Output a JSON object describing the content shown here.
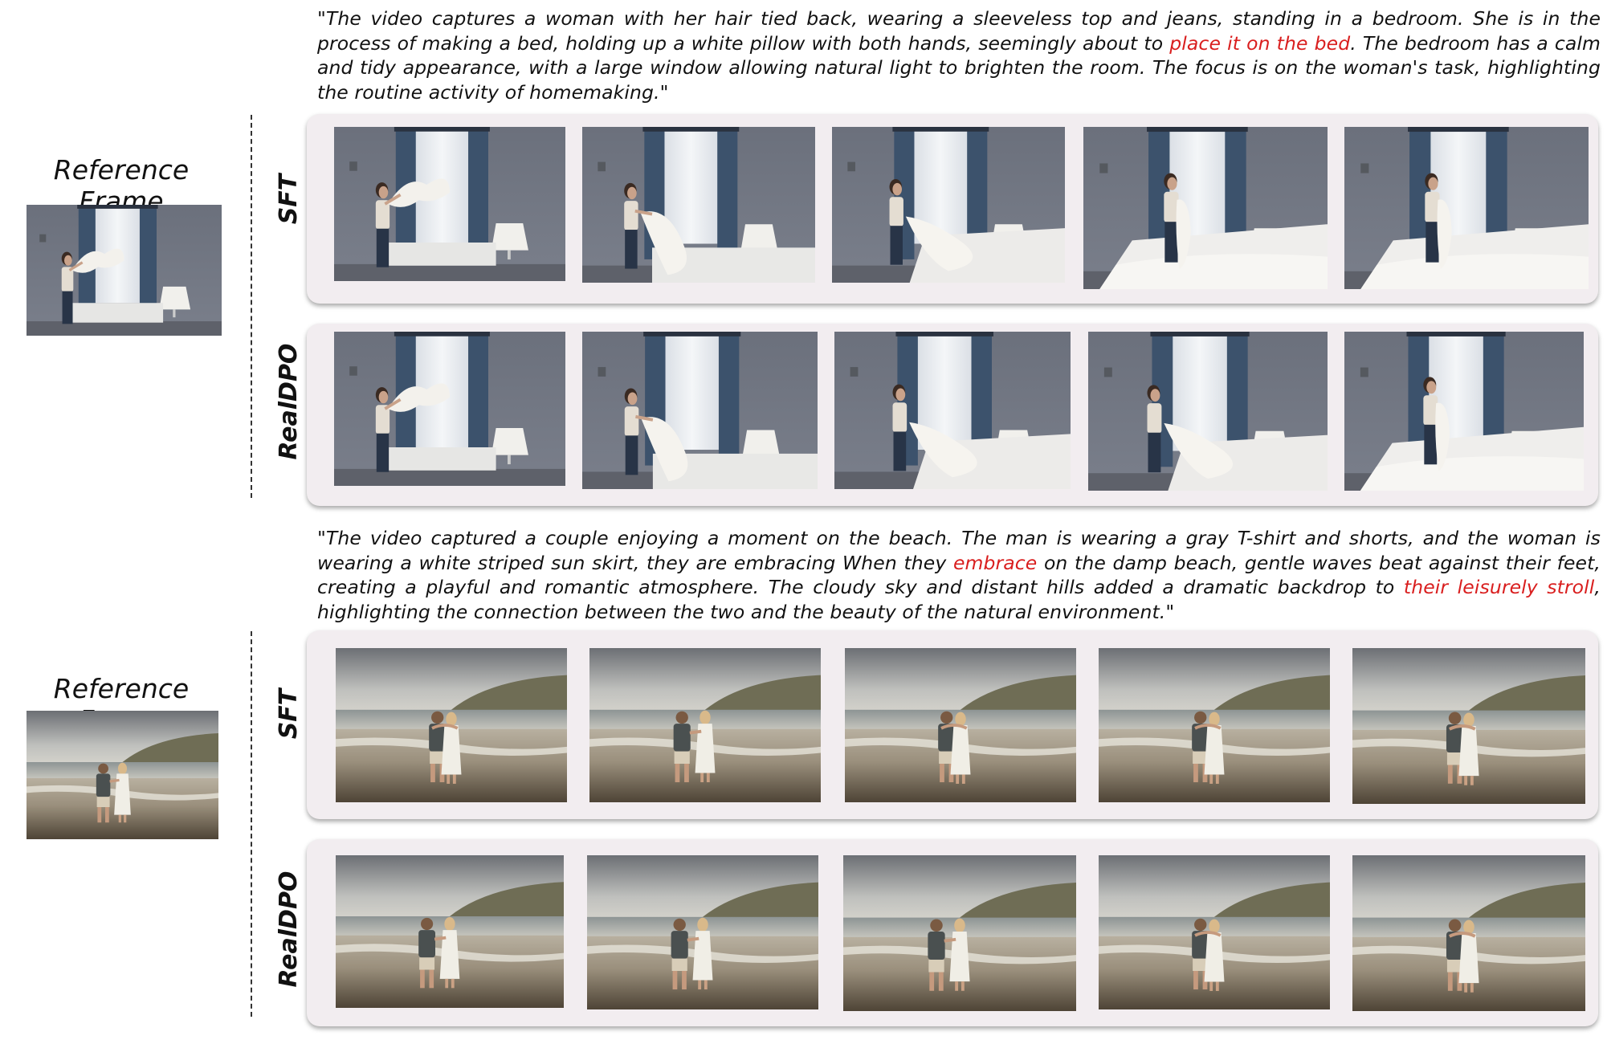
{
  "examples": [
    {
      "caption_parts": [
        {
          "text": "\"The video captures a woman with her hair tied back, wearing a sleeveless top and jeans, standing in a bedroom. She is in the process of making a bed, holding up a white pillow with both hands, seemingly about to ",
          "highlight": false
        },
        {
          "text": "place it on the bed",
          "highlight": true
        },
        {
          "text": ". The bedroom has a calm and tidy appearance, with a large window allowing natural light to brighten the room. The focus is on the woman's task, highlighting the routine activity of homemaking.\"",
          "highlight": false
        }
      ],
      "reference_label": "Reference Frame",
      "scene": "bedroom",
      "rows": [
        {
          "label": "SFT",
          "frames": 5
        },
        {
          "label": "RealDPO",
          "frames": 5
        }
      ]
    },
    {
      "caption_parts": [
        {
          "text": "\"The video captured a couple enjoying a moment on the beach. The man is wearing a gray T-shirt and shorts, and the woman is wearing a white striped sun skirt, they are embracing When they ",
          "highlight": false
        },
        {
          "text": "embrace",
          "highlight": true
        },
        {
          "text": " on the damp beach, gentle waves beat against their feet, creating a playful and romantic atmosphere. The cloudy sky and distant hills added a dramatic backdrop to ",
          "highlight": false
        },
        {
          "text": "their leisurely stroll",
          "highlight": true
        },
        {
          "text": ", highlighting the connection between the two and the beauty of the natural environment.\"",
          "highlight": false
        }
      ],
      "reference_label": "Reference Frame",
      "scene": "beach",
      "rows": [
        {
          "label": "SFT",
          "frames": 5
        },
        {
          "label": "RealDPO",
          "frames": 5
        }
      ]
    }
  ],
  "colors": {
    "highlight": "#d91e1e",
    "panel_bg": "#f2edf0",
    "text": "#111111"
  }
}
